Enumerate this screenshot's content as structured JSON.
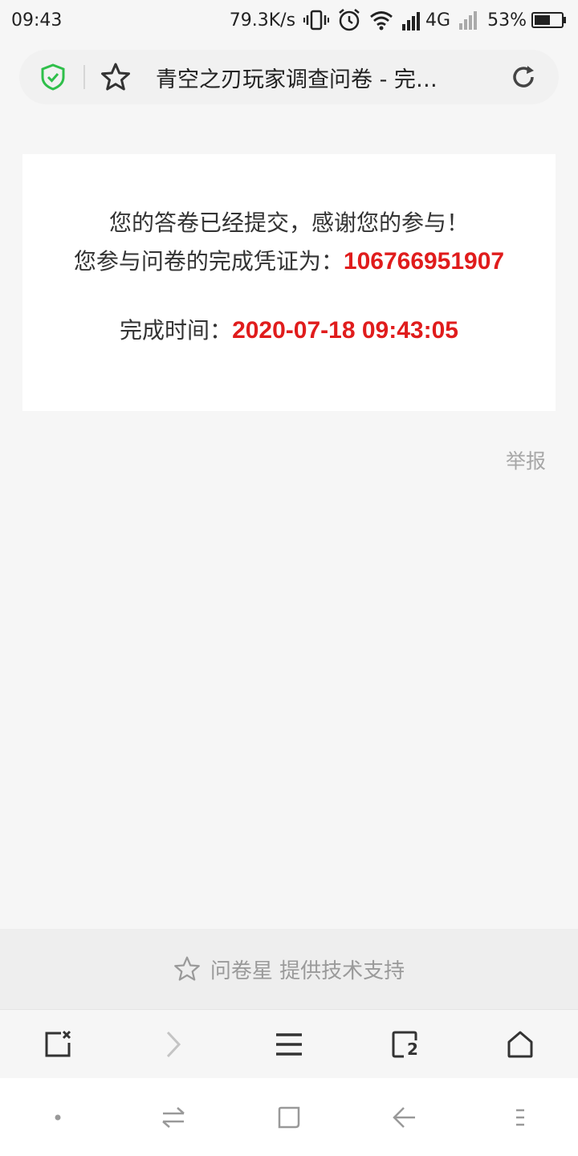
{
  "status_bar": {
    "time": "09:43",
    "network_speed": "79.3K/s",
    "network_type": "4G",
    "battery": "53%"
  },
  "address_bar": {
    "title": "青空之刃玩家调查问卷 - 完…",
    "shield_color": "#2fbf4a"
  },
  "card": {
    "line1": "您的答卷已经提交，感谢您的参与！",
    "line2_label": "您参与问卷的完成凭证为：",
    "line2_value": "106766951907",
    "line3_label": "完成时间：",
    "line3_value": "2020-07-18 09:43:05",
    "highlight_color": "#e01c1c"
  },
  "report_link": "举报",
  "support": {
    "text": "问卷星 提供技术支持"
  },
  "toolbar": {
    "tabs_count": "2"
  }
}
